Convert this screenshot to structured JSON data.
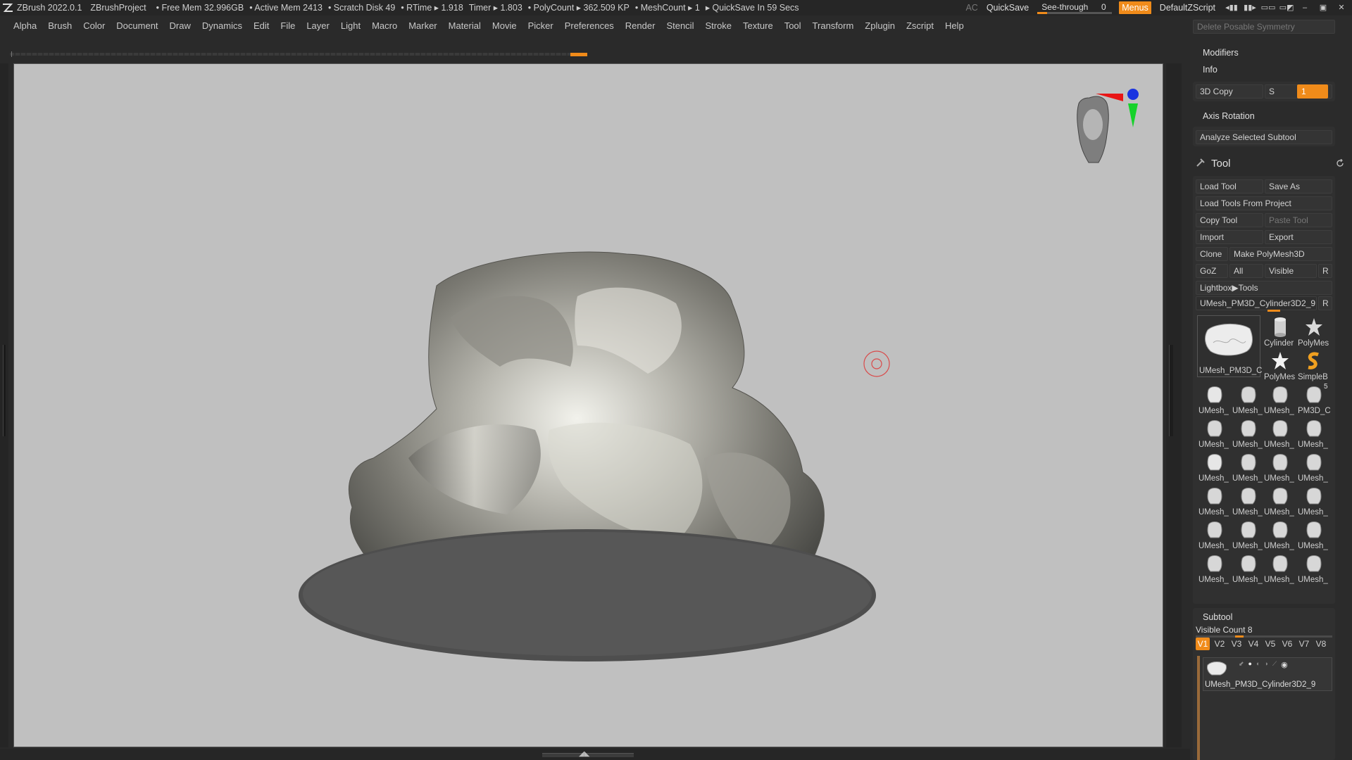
{
  "app": {
    "title": "ZBrush 2022.0.1",
    "project": "ZBrushProject",
    "stats": [
      "• Free Mem 32.996GB",
      "• Active Mem 2413",
      "• Scratch Disk 49",
      "• RTime ▸ 1.918",
      "Timer ▸ 1.803",
      "• PolyCount ▸ 362.509 KP",
      "• MeshCount ▸ 1",
      "▸ QuickSave In 59 Secs"
    ],
    "ac_label": "AC",
    "quicksave_label": "QuickSave",
    "seethrough_label": "See-through",
    "seethrough_value": "0",
    "seethrough_level": 0.13,
    "menus_label": "Menus",
    "script_label": "DefaultZScript"
  },
  "menubar": [
    "Alpha",
    "Brush",
    "Color",
    "Document",
    "Draw",
    "Dynamics",
    "Edit",
    "File",
    "Layer",
    "Light",
    "Macro",
    "Marker",
    "Material",
    "Movie",
    "Picker",
    "Preferences",
    "Render",
    "Stencil",
    "Stroke",
    "Texture",
    "Tool",
    "Transform",
    "Zplugin",
    "Zscript",
    "Help"
  ],
  "panel": {
    "delete_posable_symmetry": "Delete Posable Symmetry",
    "modifiers": "Modifiers",
    "info": "Info",
    "copy3d": "3D Copy",
    "s_label": "S",
    "s_value": "1",
    "axis_rotation": "Axis Rotation",
    "analyze": "Analyze Selected Subtool",
    "tool_header": "Tool",
    "load_tool": "Load Tool",
    "save_as": "Save As",
    "load_from_project": "Load Tools From Project",
    "copy_tool": "Copy Tool",
    "paste_tool": "Paste Tool",
    "import": "Import",
    "export": "Export",
    "clone": "Clone",
    "make_polymesh": "Make PolyMesh3D",
    "goz": "GoZ",
    "all": "All",
    "visible": "Visible",
    "r": "R",
    "lightbox_tools": "Lightbox▶Tools",
    "current_tool": "UMesh_PM3D_Cylinder3D2_9",
    "current_tool_r": "R",
    "big_thumb_caption": "UMesh_PM3D_C",
    "thumb_small": [
      {
        "caption": "Cylinder",
        "icon": "cylinder-icon"
      },
      {
        "caption": "PolyMes",
        "icon": "star-icon"
      },
      {
        "caption": "PolyMes",
        "icon": "star-icon"
      },
      {
        "caption": "SimpleB",
        "icon": "simplebrush-icon"
      }
    ],
    "thumb_grid": [
      "UMesh_",
      "UMesh_",
      "UMesh_",
      "PM3D_C",
      "UMesh_",
      "UMesh_",
      "UMesh_",
      "UMesh_",
      "UMesh_",
      "UMesh_",
      "UMesh_",
      "UMesh_",
      "UMesh_",
      "UMesh_",
      "UMesh_",
      "UMesh_",
      "UMesh_",
      "UMesh_",
      "UMesh_",
      "UMesh_",
      "UMesh_",
      "UMesh_",
      "UMesh_",
      "UMesh_"
    ],
    "thumb_badge": "5",
    "subtool_header": "Subtool",
    "visible_count_label": "Visible Count",
    "visible_count_value": "8",
    "vtabs": [
      "V1",
      "V2",
      "V3",
      "V4",
      "V5",
      "V6",
      "V7",
      "V8"
    ],
    "subtool_item": "UMesh_PM3D_Cylinder3D2_9"
  },
  "colors": {
    "accent": "#f08b1a",
    "canvas_bg": "#c0c0c0",
    "ui_bg": "#2a2a2a"
  }
}
